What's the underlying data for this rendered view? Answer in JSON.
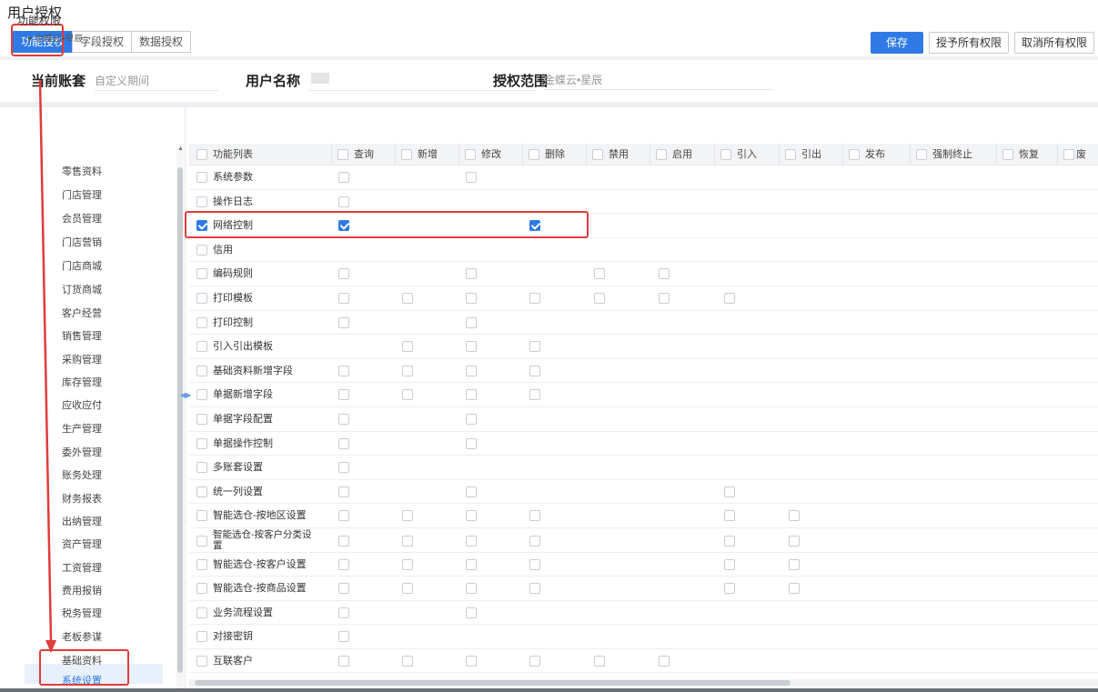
{
  "page_title": "用户授权",
  "tabs": [
    {
      "label": "功能授权",
      "active": true
    },
    {
      "label": "字段授权",
      "active": false
    },
    {
      "label": "数据授权",
      "active": false
    }
  ],
  "buttons": {
    "save": "保存",
    "grant_all": "授予所有权限",
    "cancel_all": "取消所有权限"
  },
  "info": {
    "account_label": "当前账套",
    "account_value": "自定义期间",
    "user_label": "用户名称",
    "user_value": "",
    "scope_label": "授权范围",
    "scope_value": "金蝶云•星辰"
  },
  "left_panel": {
    "title": "功能权限",
    "root": "金蝶云•星辰",
    "items": [
      "零售资料",
      "门店管理",
      "会员管理",
      "门店营销",
      "门店商城",
      "订货商城",
      "客户经营",
      "销售管理",
      "采购管理",
      "库存管理",
      "应收应付",
      "生产管理",
      "委外管理",
      "账务处理",
      "财务报表",
      "出纳管理",
      "资产管理",
      "工资管理",
      "费用报销",
      "税务管理",
      "老板参谋",
      "基础资料",
      "系统设置"
    ],
    "selected": "系统设置"
  },
  "grid": {
    "columns": [
      "功能列表",
      "查询",
      "新增",
      "修改",
      "删除",
      "禁用",
      "启用",
      "引入",
      "引出",
      "发布",
      "强制终止",
      "恢复",
      "废"
    ],
    "rows": [
      {
        "name": "系统参数",
        "boxes": [
          1,
          0,
          1,
          0,
          0,
          0,
          0,
          0,
          0,
          0,
          0,
          0
        ],
        "checked": [
          0,
          0,
          0,
          0,
          0,
          0,
          0,
          0,
          0,
          0,
          0,
          0
        ],
        "row_checked": false
      },
      {
        "name": "操作日志",
        "boxes": [
          1,
          0,
          0,
          0,
          0,
          0,
          0,
          0,
          0,
          0,
          0,
          0
        ],
        "checked": [
          0,
          0,
          0,
          0,
          0,
          0,
          0,
          0,
          0,
          0,
          0,
          0
        ],
        "row_checked": false
      },
      {
        "name": "网络控制",
        "boxes": [
          1,
          0,
          0,
          1,
          0,
          0,
          0,
          0,
          0,
          0,
          0,
          0
        ],
        "checked": [
          1,
          0,
          0,
          1,
          0,
          0,
          0,
          0,
          0,
          0,
          0,
          0
        ],
        "row_checked": true
      },
      {
        "name": "信用",
        "boxes": [
          0,
          0,
          0,
          0,
          0,
          0,
          0,
          0,
          0,
          0,
          0,
          0
        ],
        "checked": [
          0,
          0,
          0,
          0,
          0,
          0,
          0,
          0,
          0,
          0,
          0,
          0
        ],
        "row_checked": false
      },
      {
        "name": "编码规则",
        "boxes": [
          1,
          0,
          1,
          0,
          1,
          1,
          0,
          0,
          0,
          0,
          0,
          0
        ],
        "checked": [
          0,
          0,
          0,
          0,
          0,
          0,
          0,
          0,
          0,
          0,
          0,
          0
        ],
        "row_checked": false
      },
      {
        "name": "打印模板",
        "boxes": [
          1,
          1,
          1,
          1,
          1,
          1,
          1,
          0,
          0,
          0,
          0,
          0
        ],
        "checked": [
          0,
          0,
          0,
          0,
          0,
          0,
          0,
          0,
          0,
          0,
          0,
          0
        ],
        "row_checked": false
      },
      {
        "name": "打印控制",
        "boxes": [
          1,
          0,
          1,
          0,
          0,
          0,
          0,
          0,
          0,
          0,
          0,
          0
        ],
        "checked": [
          0,
          0,
          0,
          0,
          0,
          0,
          0,
          0,
          0,
          0,
          0,
          0
        ],
        "row_checked": false
      },
      {
        "name": "引入引出模板",
        "boxes": [
          0,
          1,
          1,
          1,
          0,
          0,
          0,
          0,
          0,
          0,
          0,
          0
        ],
        "checked": [
          0,
          0,
          0,
          0,
          0,
          0,
          0,
          0,
          0,
          0,
          0,
          0
        ],
        "row_checked": false
      },
      {
        "name": "基础资料新增字段",
        "boxes": [
          1,
          1,
          1,
          1,
          0,
          0,
          0,
          0,
          0,
          0,
          0,
          0
        ],
        "checked": [
          0,
          0,
          0,
          0,
          0,
          0,
          0,
          0,
          0,
          0,
          0,
          0
        ],
        "row_checked": false
      },
      {
        "name": "单据新增字段",
        "boxes": [
          1,
          1,
          1,
          1,
          0,
          0,
          0,
          0,
          0,
          0,
          0,
          0
        ],
        "checked": [
          0,
          0,
          0,
          0,
          0,
          0,
          0,
          0,
          0,
          0,
          0,
          0
        ],
        "row_checked": false
      },
      {
        "name": "单据字段配置",
        "boxes": [
          1,
          0,
          1,
          0,
          0,
          0,
          0,
          0,
          0,
          0,
          0,
          0
        ],
        "checked": [
          0,
          0,
          0,
          0,
          0,
          0,
          0,
          0,
          0,
          0,
          0,
          0
        ],
        "row_checked": false
      },
      {
        "name": "单据操作控制",
        "boxes": [
          1,
          0,
          1,
          0,
          0,
          0,
          0,
          0,
          0,
          0,
          0,
          0
        ],
        "checked": [
          0,
          0,
          0,
          0,
          0,
          0,
          0,
          0,
          0,
          0,
          0,
          0
        ],
        "row_checked": false
      },
      {
        "name": "多账套设置",
        "boxes": [
          1,
          0,
          0,
          0,
          0,
          0,
          0,
          0,
          0,
          0,
          0,
          0
        ],
        "checked": [
          0,
          0,
          0,
          0,
          0,
          0,
          0,
          0,
          0,
          0,
          0,
          0
        ],
        "row_checked": false
      },
      {
        "name": "统一列设置",
        "boxes": [
          1,
          0,
          1,
          0,
          0,
          0,
          1,
          0,
          0,
          0,
          0,
          0
        ],
        "checked": [
          0,
          0,
          0,
          0,
          0,
          0,
          0,
          0,
          0,
          0,
          0,
          0
        ],
        "row_checked": false
      },
      {
        "name": "智能选仓-按地区设置",
        "boxes": [
          1,
          1,
          1,
          1,
          0,
          0,
          1,
          1,
          0,
          0,
          0,
          0
        ],
        "checked": [
          0,
          0,
          0,
          0,
          0,
          0,
          0,
          0,
          0,
          0,
          0,
          0
        ],
        "row_checked": false
      },
      {
        "name": "智能选仓-按客户分类设置",
        "boxes": [
          1,
          1,
          1,
          1,
          0,
          0,
          1,
          1,
          0,
          0,
          0,
          0
        ],
        "checked": [
          0,
          0,
          0,
          0,
          0,
          0,
          0,
          0,
          0,
          0,
          0,
          0
        ],
        "row_checked": false
      },
      {
        "name": "智能选仓-按客户设置",
        "boxes": [
          1,
          1,
          1,
          1,
          0,
          0,
          1,
          1,
          0,
          0,
          0,
          0
        ],
        "checked": [
          0,
          0,
          0,
          0,
          0,
          0,
          0,
          0,
          0,
          0,
          0,
          0
        ],
        "row_checked": false
      },
      {
        "name": "智能选仓-按商品设置",
        "boxes": [
          1,
          1,
          1,
          1,
          0,
          0,
          1,
          1,
          0,
          0,
          0,
          0
        ],
        "checked": [
          0,
          0,
          0,
          0,
          0,
          0,
          0,
          0,
          0,
          0,
          0,
          0
        ],
        "row_checked": false
      },
      {
        "name": "业务流程设置",
        "boxes": [
          1,
          0,
          1,
          0,
          0,
          0,
          0,
          0,
          0,
          0,
          0,
          0
        ],
        "checked": [
          0,
          0,
          0,
          0,
          0,
          0,
          0,
          0,
          0,
          0,
          0,
          0
        ],
        "row_checked": false
      },
      {
        "name": "对接密钥",
        "boxes": [
          1,
          0,
          0,
          0,
          0,
          0,
          0,
          0,
          0,
          0,
          0,
          0
        ],
        "checked": [
          0,
          0,
          0,
          0,
          0,
          0,
          0,
          0,
          0,
          0,
          0,
          0
        ],
        "row_checked": false
      },
      {
        "name": "互联客户",
        "boxes": [
          1,
          1,
          1,
          1,
          1,
          1,
          0,
          0,
          0,
          0,
          0,
          0
        ],
        "checked": [
          0,
          0,
          0,
          0,
          0,
          0,
          0,
          0,
          0,
          0,
          0,
          0
        ],
        "row_checked": false
      }
    ]
  },
  "colors": {
    "accent": "#2f7ae5",
    "highlight": "#e23b3b"
  }
}
